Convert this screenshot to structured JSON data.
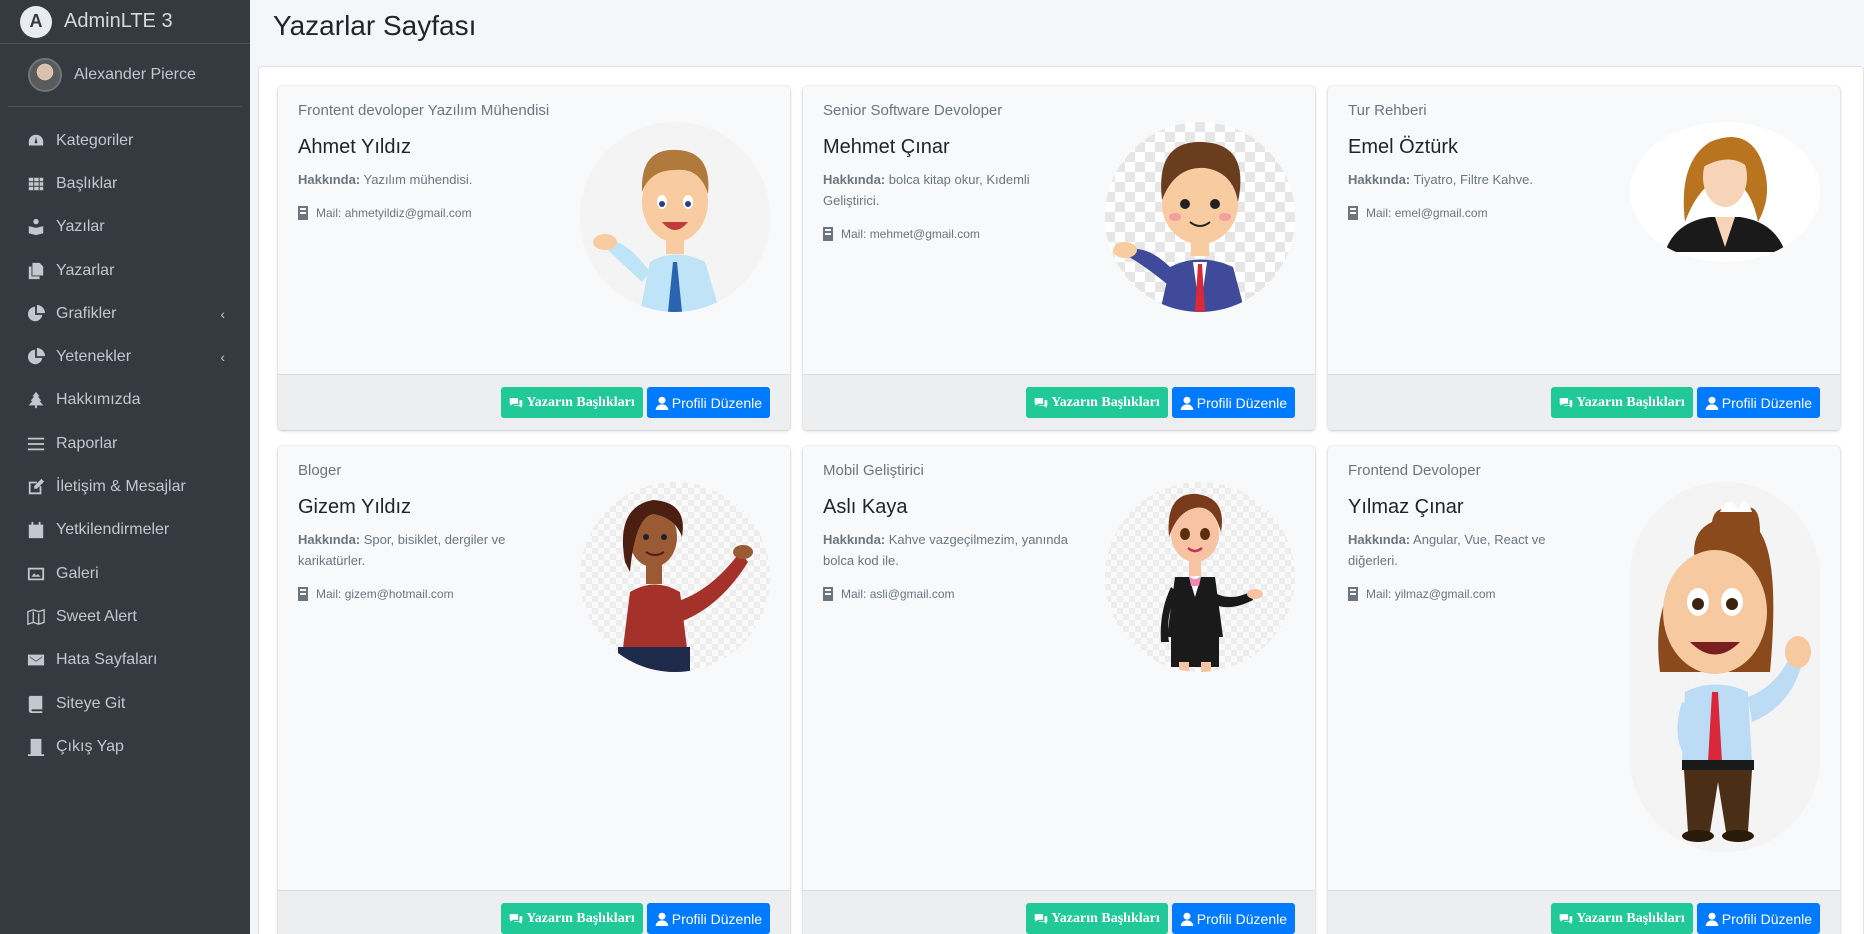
{
  "brand": {
    "title": "AdminLTE 3",
    "logo_letter": "A"
  },
  "user": {
    "name": "Alexander Pierce"
  },
  "nav": [
    {
      "label": "Kategoriler",
      "icon": "dashboard-icon"
    },
    {
      "label": "Başlıklar",
      "icon": "grid-icon"
    },
    {
      "label": "Yazılar",
      "icon": "book-reader-icon"
    },
    {
      "label": "Yazarlar",
      "icon": "copy-icon"
    },
    {
      "label": "Grafikler",
      "icon": "chart-pie-icon",
      "expand": "‹"
    },
    {
      "label": "Yetenekler",
      "icon": "chart-pie-icon",
      "expand": "‹"
    },
    {
      "label": "Hakkımızda",
      "icon": "tree-icon"
    },
    {
      "label": "Raporlar",
      "icon": "bars-icon"
    },
    {
      "label": "İletişim & Mesajlar",
      "icon": "edit-icon"
    },
    {
      "label": "Yetkilendirmeler",
      "icon": "calendar-icon"
    },
    {
      "label": "Galeri",
      "icon": "image-icon"
    },
    {
      "label": "Sweet Alert",
      "icon": "map-icon"
    },
    {
      "label": "Hata Sayfaları",
      "icon": "envelope-icon"
    },
    {
      "label": "Siteye Git",
      "icon": "book-icon"
    },
    {
      "label": "Çıkış Yap",
      "icon": "door-icon"
    }
  ],
  "page": {
    "title": "Yazarlar Sayfası"
  },
  "labels": {
    "about_prefix": "Hakkında:",
    "mail_prefix": "Mail:"
  },
  "buttons": {
    "titles": "Yazarın Başlıkları",
    "edit": "Profili Düzenle"
  },
  "authors": [
    {
      "role": "Frontent devoloper Yazılım Mühendisi",
      "name": "Ahmet Yıldız",
      "about": "Yazılım mühendisi.",
      "mail": "ahmetyildiz@gmail.com",
      "avatar": "male-cartoon-avatar"
    },
    {
      "role": "Senior Software Devoloper",
      "name": "Mehmet Çınar",
      "about": "bolca kitap okur, Kıdemli Geliştirici.",
      "mail": "mehmet@gmail.com",
      "avatar": "male-suit-cartoon-avatar"
    },
    {
      "role": "Tur Rehberi",
      "name": "Emel Öztürk",
      "about": "Tiyatro, Filtre Kahve.",
      "mail": "emel@gmail.com",
      "avatar": "female-silhouette-avatar"
    },
    {
      "role": "Bloger",
      "name": "Gizem Yıldız",
      "about": "Spor, bisiklet, dergiler ve karikatürler.",
      "mail": "gizem@hotmail.com",
      "avatar": "female-cartoon-avatar"
    },
    {
      "role": "Mobil Geliştirici",
      "name": "Aslı Kaya",
      "about": "Kahve vazgeçilmezim, yanında bolca kod ile.",
      "mail": "asli@gmail.com",
      "avatar": "female-suit-cartoon-avatar"
    },
    {
      "role": "Frontend Devoloper",
      "name": "Yılmaz Çınar",
      "about": "Angular, Vue, React ve diğerleri.",
      "mail": "yilmaz@gmail.com",
      "avatar": "male-waving-cartoon-avatar"
    }
  ]
}
